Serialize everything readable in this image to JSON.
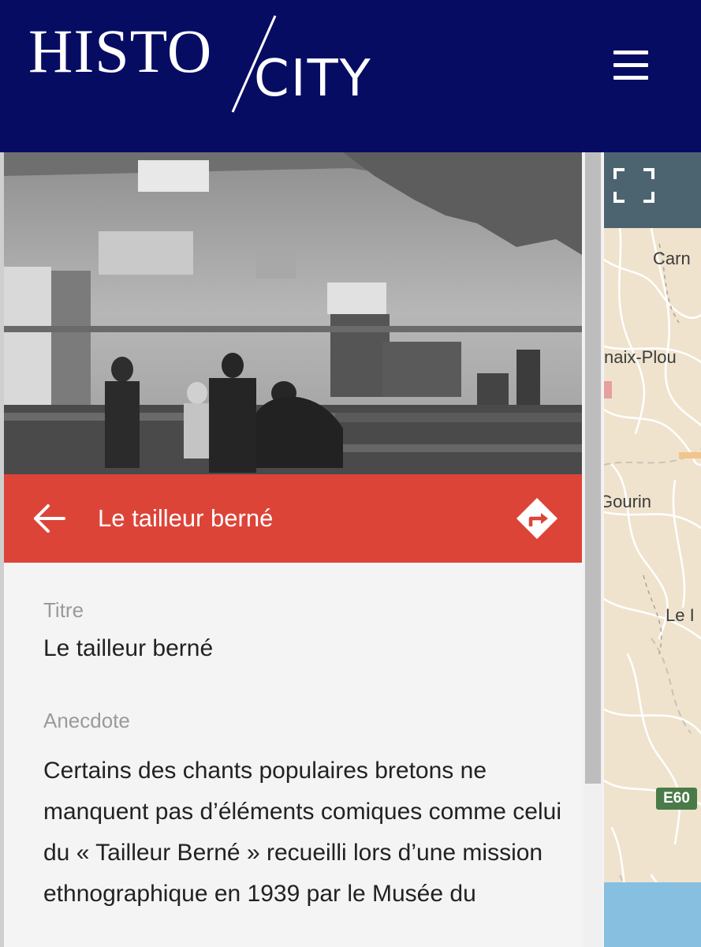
{
  "header": {
    "logo_part1": "HISTO",
    "logo_part2": "CITY",
    "background_color": "#070c63",
    "menu_icon": "hamburger-menu-icon"
  },
  "article": {
    "photo_alt": "Photo d'archive en noir et blanc : atelier avec des personnes assises à des tables",
    "title": "Le tailleur berné",
    "back_icon": "arrow-left-icon",
    "route_icon": "directions-icon",
    "accent_color": "#dd4438",
    "fields": {
      "titre_label": "Titre",
      "titre_value": "Le tailleur berné",
      "anecdote_label": "Anecdote",
      "anecdote_value": "Certains des chants populaires bretons ne manquent pas d’éléments comiques comme celui du « Tailleur Berné » recueilli lors d’une mission ethnographique en 1939 par le Musée du"
    }
  },
  "map": {
    "fullscreen_icon": "fullscreen-icon",
    "labels": {
      "carn": "Carn",
      "naix": "naix-Plou",
      "gourin": "Gourin",
      "le": "Le I"
    },
    "road_badge": "E60"
  }
}
